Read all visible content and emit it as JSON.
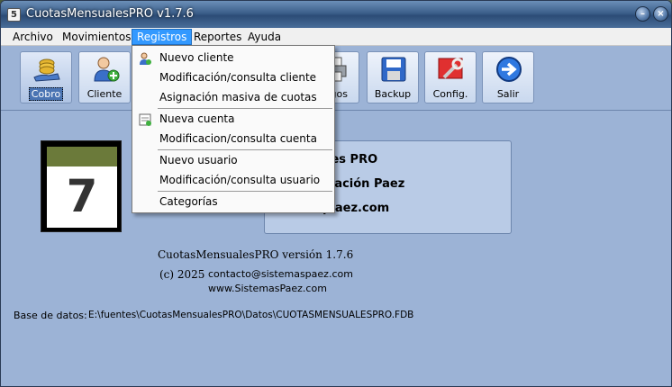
{
  "window": {
    "title": "CuotasMensualesPRO v1.7.6",
    "app_icon_glyph": "5"
  },
  "menubar": {
    "items": [
      {
        "label": "Archivo"
      },
      {
        "label": "Movimientos"
      },
      {
        "label": "Registros"
      },
      {
        "label": "Reportes"
      },
      {
        "label": "Ayuda"
      }
    ],
    "active": "Registros"
  },
  "toolbar": {
    "buttons": [
      {
        "label": "Cobro",
        "icon": "coins-hand-icon"
      },
      {
        "label": "Cliente",
        "icon": "user-add-icon"
      },
      {
        "label": "gos",
        "icon": "printer-icon"
      },
      {
        "label": "Backup",
        "icon": "floppy-disk-icon"
      },
      {
        "label": "Config.",
        "icon": "wrench-icon"
      },
      {
        "label": "Salir",
        "icon": "arrow-right-icon"
      }
    ]
  },
  "dropdown": {
    "items": [
      {
        "label": "Nuevo cliente",
        "icon": "user-icon"
      },
      {
        "label": "Modificación/consulta cliente"
      },
      {
        "label": "Asignación masiva de cuotas"
      },
      {
        "label": "Nueva cuenta",
        "icon": "account-sheet-icon"
      },
      {
        "label": "Modificacion/consulta cuenta"
      },
      {
        "label": "Nuevo usuario"
      },
      {
        "label": "Modificación/consulta usuario"
      },
      {
        "label": "Categorías"
      }
    ]
  },
  "main": {
    "calendar_number": "7",
    "info_lines": [
      "nsuales PRO",
      "aformación Paez",
      "masp aez.com"
    ],
    "about_title": "CuotasMensualesPRO versión 1.7.6",
    "copyright": "(c) 2025",
    "contact_email": "contacto@sistemaspaez.com",
    "website": "www.SistemasPaez.com",
    "db_label": "Base de datos:",
    "db_path": "E:\\fuentes\\CuotasMensualesPRO\\Datos\\CUOTASMENSUALESPRO.FDB"
  },
  "colors": {
    "accent": "#3399ff",
    "window_bg": "#9cb3d6"
  }
}
